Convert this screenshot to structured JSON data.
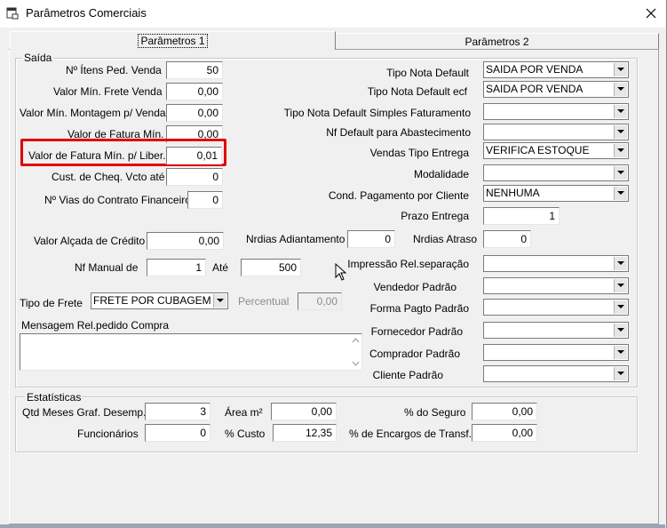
{
  "window": {
    "title": "Parâmetros Comerciais"
  },
  "tabs": [
    {
      "label": "Parâmetros 1"
    },
    {
      "label": "Parâmetros 2"
    }
  ],
  "saida": {
    "title": "Saída",
    "nitens": {
      "label": "Nº Ítens Ped. Venda",
      "value": "50"
    },
    "vminfrete": {
      "label": "Valor Mín. Frete Venda",
      "value": "0,00"
    },
    "vminmontagem": {
      "label": "Valor Mín. Montagem p/ Venda",
      "value": "0,00"
    },
    "vfaturamin": {
      "label": "Valor de Fatura Mín.",
      "value": "0,00"
    },
    "vfaturaliber": {
      "label": "Valor de Fatura Mín. p/ Liber.",
      "value": "0,01"
    },
    "custcheq": {
      "label": "Cust. de Cheq. Vcto até",
      "value": "0"
    },
    "nvias": {
      "label": "Nº Vias do Contrato Financeiro",
      "value": "0"
    },
    "alcada": {
      "label": "Valor Alçada de Crédito",
      "value": "0,00"
    },
    "nrdiasadiant": {
      "label": "Nrdias Adiantamento",
      "value": "0"
    },
    "nrdiasatraso": {
      "label": "Nrdias Atraso",
      "value": "0"
    },
    "nfmanual": {
      "label": "Nf Manual de",
      "from": "1",
      "ate_label": "Até",
      "to": "500"
    },
    "tipofrete": {
      "label": "Tipo de Frete",
      "value": "FRETE POR CUBAGEM"
    },
    "percentual": {
      "label": "Percentual",
      "value": "0,00"
    },
    "mensagem": {
      "label": "Mensagem Rel.pedido Compra",
      "value": ""
    },
    "tiponota": {
      "label": "Tipo Nota Default",
      "value": "SAIDA POR VENDA"
    },
    "tiponotaecf": {
      "label": "Tipo Nota Default ecf",
      "value": "SAIDA POR VENDA"
    },
    "tiponotasimples": {
      "label": "Tipo Nota Default Simples Faturamento",
      "value": ""
    },
    "nfabastecimento": {
      "label": "Nf Default para Abastecimento",
      "value": ""
    },
    "vendastipo": {
      "label": "Vendas Tipo Entrega",
      "value": "VERIFICA ESTOQUE"
    },
    "modalidade": {
      "label": "Modalidade",
      "value": ""
    },
    "condpagto": {
      "label": "Cond. Pagamento por Cliente",
      "value": "NENHUMA"
    },
    "prazoentrega": {
      "label": "Prazo Entrega",
      "value": "1"
    },
    "impressao": {
      "label": "Impressão Rel.separação",
      "value": ""
    },
    "vendedor": {
      "label": "Vendedor Padrão",
      "value": ""
    },
    "formapagto": {
      "label": "Forma Pagto Padrão",
      "value": ""
    },
    "fornecedor": {
      "label": "Fornecedor Padrão",
      "value": ""
    },
    "comprador": {
      "label": "Comprador Padrão",
      "value": ""
    },
    "cliente": {
      "label": "Cliente Padrão",
      "value": ""
    }
  },
  "estatisticas": {
    "title": "Estatísticas",
    "qtdmeses": {
      "label": "Qtd Meses Graf. Desemp.",
      "value": "3"
    },
    "area": {
      "label": "Área m²",
      "value": "0,00"
    },
    "seguro": {
      "label": "% do Seguro",
      "value": "0,00"
    },
    "funcionarios": {
      "label": "Funcionários",
      "value": "0"
    },
    "custo": {
      "label": "% Custo",
      "value": "12,35"
    },
    "encargos": {
      "label": "% de Encargos de Transf.",
      "value": "0,00"
    }
  },
  "highlight_color": "#e00000"
}
